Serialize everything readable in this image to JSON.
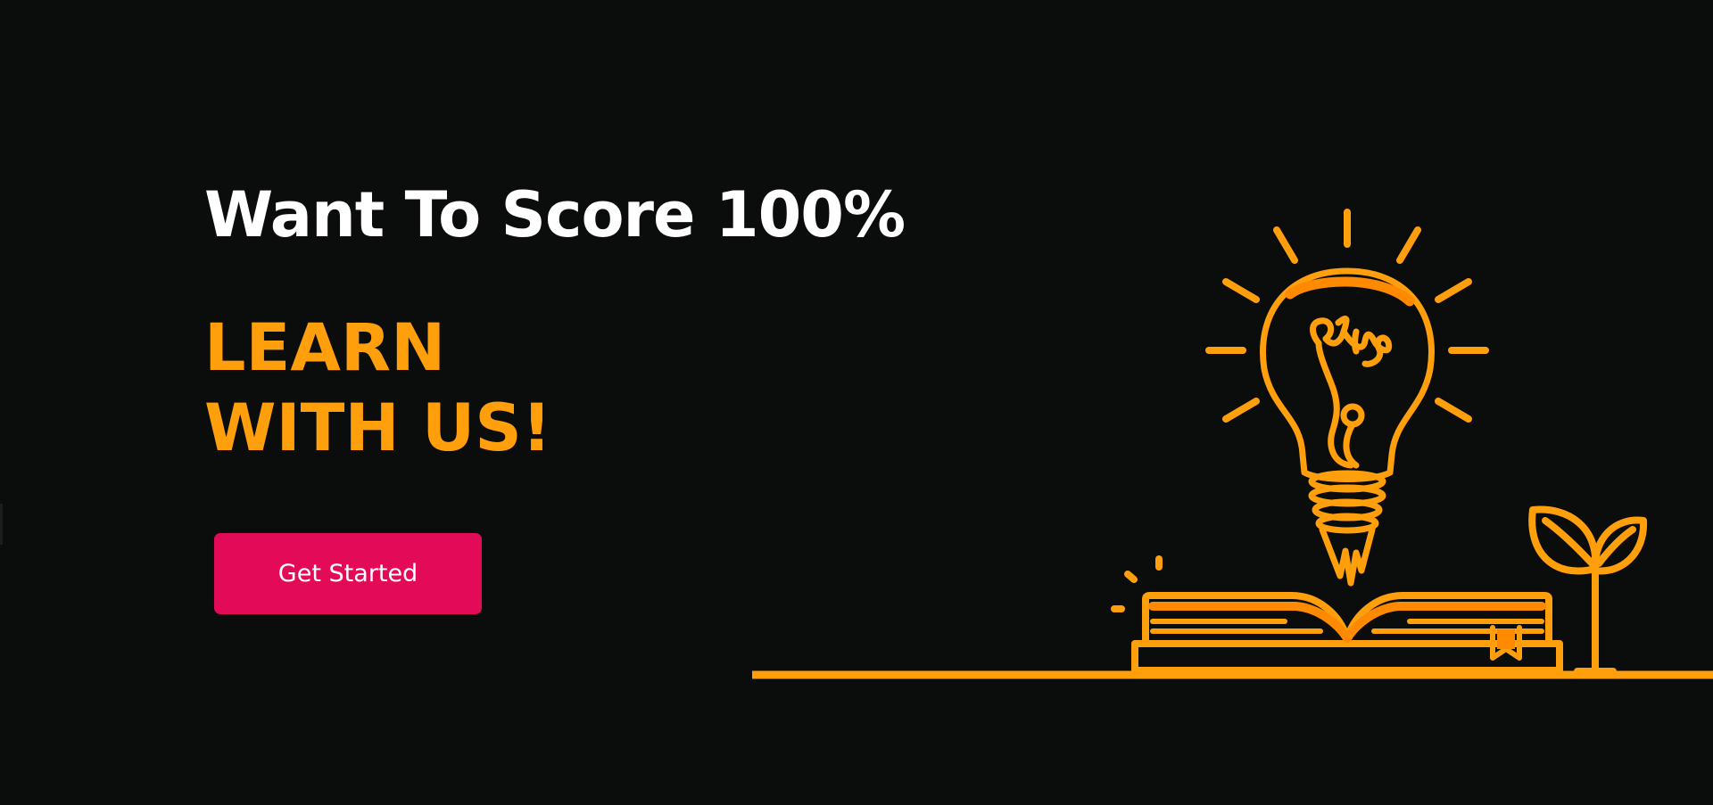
{
  "hero": {
    "headline": "Want To Score 100%",
    "tagline_line1": "LEARN",
    "tagline_line2": "WITH US!",
    "cta_label": "Get Started"
  },
  "colors": {
    "background": "#0b0c0c",
    "headline": "#ffffff",
    "accent": "#ff9f0c",
    "accent_fill": "#ff8a00",
    "button": "#e30b57"
  },
  "illustration": {
    "icons": [
      "lightbulb-icon",
      "open-book-icon",
      "plant-sprout-icon"
    ]
  }
}
